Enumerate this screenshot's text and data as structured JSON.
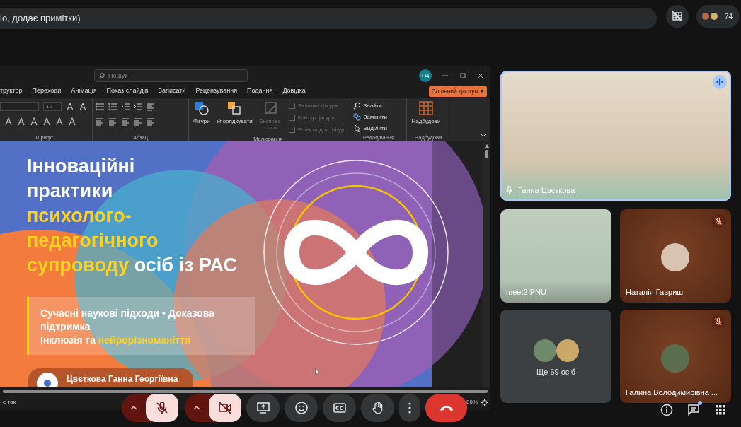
{
  "caption": {
    "text": "іо, додає примітки)"
  },
  "participants": {
    "count": "74"
  },
  "presentation": {
    "search": {
      "placeholder": "Пошук"
    },
    "account_initials": "ГЦ",
    "tabs": [
      {
        "label": "труктор"
      },
      {
        "label": "Переходи"
      },
      {
        "label": "Анімація"
      },
      {
        "label": "Показ слайдів"
      },
      {
        "label": "Записати"
      },
      {
        "label": "Рецензування"
      },
      {
        "label": "Подання"
      },
      {
        "label": "Довідка"
      }
    ],
    "share_button": "Спільний доступ",
    "ribbon": [
      {
        "kind": "font",
        "label": "Шрифт",
        "font_size": "12"
      },
      {
        "kind": "paragraph",
        "label": "Абзац"
      },
      {
        "kind": "drawing",
        "label": "Малювання",
        "buttons": [
          {
            "label": "Фігури",
            "disabled": false
          },
          {
            "label": "Упорядкувати",
            "disabled": false
          },
          {
            "label": "Експрес-стилі",
            "disabled": true
          }
        ],
        "commands": [
          {
            "label": "Заливка фігури",
            "disabled": true
          },
          {
            "label": "Контур фігури",
            "disabled": true
          },
          {
            "label": "Ефекти для фігур",
            "disabled": true
          }
        ]
      },
      {
        "kind": "editing",
        "label": "Редагування",
        "commands": [
          {
            "label": "Знайти",
            "disabled": false
          },
          {
            "label": "Замінити",
            "disabled": false
          },
          {
            "label": "Виділити",
            "disabled": false
          }
        ]
      },
      {
        "kind": "addins",
        "label": "Надбудови",
        "buttons": [
          {
            "label": "Надбудови",
            "disabled": false
          }
        ]
      }
    ],
    "slide": {
      "title": [
        [
          {
            "text": "Інноваційні",
            "accent": false
          }
        ],
        [
          {
            "text": "практики",
            "accent": false
          }
        ],
        [
          {
            "text": "психолого-",
            "accent": true
          }
        ],
        [
          {
            "text": "педагогічного",
            "accent": true
          }
        ],
        [
          {
            "text": "супроводу",
            "accent": true
          },
          {
            "text": " осіб із РАС",
            "accent": false
          }
        ]
      ],
      "subtitle": [
        [
          {
            "text": "Сучасні наукові підходи • Доказова підтримка",
            "accent": false
          }
        ],
        [
          {
            "text": "Інклюзія та ",
            "accent": false
          },
          {
            "text": "нейрорізноманіття",
            "accent": true
          }
        ]
      ],
      "presenter": "Цвєткова Ганна Георгіївна"
    },
    "status_left": "е так",
    "zoom": "80%"
  },
  "controls": [
    {
      "kind": "mic",
      "on": false
    },
    {
      "kind": "camera",
      "on": false
    },
    {
      "kind": "present"
    },
    {
      "kind": "reactions"
    },
    {
      "kind": "captions"
    },
    {
      "kind": "hand"
    },
    {
      "kind": "more"
    },
    {
      "kind": "leave"
    }
  ],
  "main_tile": {
    "name": "Ганна Цвєткова",
    "speaking": true
  },
  "tiles": [
    {
      "kind": "video",
      "name": "meet2 PNU",
      "muted": false
    },
    {
      "kind": "avatar",
      "name": "Наталія Гавриш",
      "muted": true
    },
    {
      "kind": "others",
      "name": "Ще 69 осіб",
      "muted": false
    },
    {
      "kind": "avatar",
      "name": "Галина Володимирівна ...",
      "muted": true
    }
  ],
  "chat_unread": true
}
